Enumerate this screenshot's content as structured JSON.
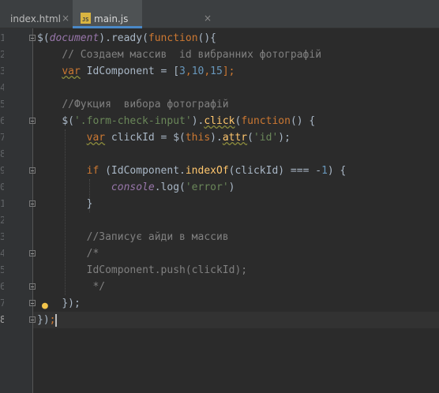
{
  "tabs": [
    {
      "label": "index.html",
      "close": "×"
    },
    {
      "label": "main.js",
      "close": "×",
      "icon_text": "JS"
    }
  ],
  "line_numbers": [
    "1",
    "2",
    "3",
    "4",
    "5",
    "6",
    "7",
    "8",
    "9",
    "0",
    "1",
    "2",
    "3",
    "4",
    "5",
    "6",
    "7",
    "8"
  ],
  "code": {
    "l1": [
      "$(",
      "document",
      ").",
      "ready",
      "(",
      "function",
      "(){"
    ],
    "l2": "// Создаем массив  id вибранних фотографій",
    "l3": [
      "var",
      " IdComponent = [",
      "3",
      ",",
      "10",
      ",",
      "15",
      "];"
    ],
    "l5": "//Фукция  вибора фотографій",
    "l6": [
      "$(",
      "'.form-check-input'",
      ").",
      "click",
      "(",
      "function",
      "() {"
    ],
    "l7": [
      "var",
      " clickId = $(",
      "this",
      ").",
      "attr",
      "(",
      "'id'",
      ");"
    ],
    "l9": [
      "if",
      " (IdComponent.",
      "indexOf",
      "(clickId) === -",
      "1",
      ") {"
    ],
    "l10": [
      "console",
      ".log(",
      "'error'",
      ")"
    ],
    "l11": "}",
    "l13": "//Записує айди в массив",
    "l14": "/*",
    "l15": "IdComponent.push(clickId);",
    "l16": " */",
    "l17": "});",
    "l18": [
      "})",
      ";"
    ]
  },
  "colors": {
    "keyword": "#cc7832",
    "number": "#6897bb",
    "string": "#6a8759",
    "comment": "#808080",
    "function": "#ffc66d",
    "background": "#2b2b2b"
  },
  "icons": {
    "bulb": "lightbulb-icon"
  }
}
